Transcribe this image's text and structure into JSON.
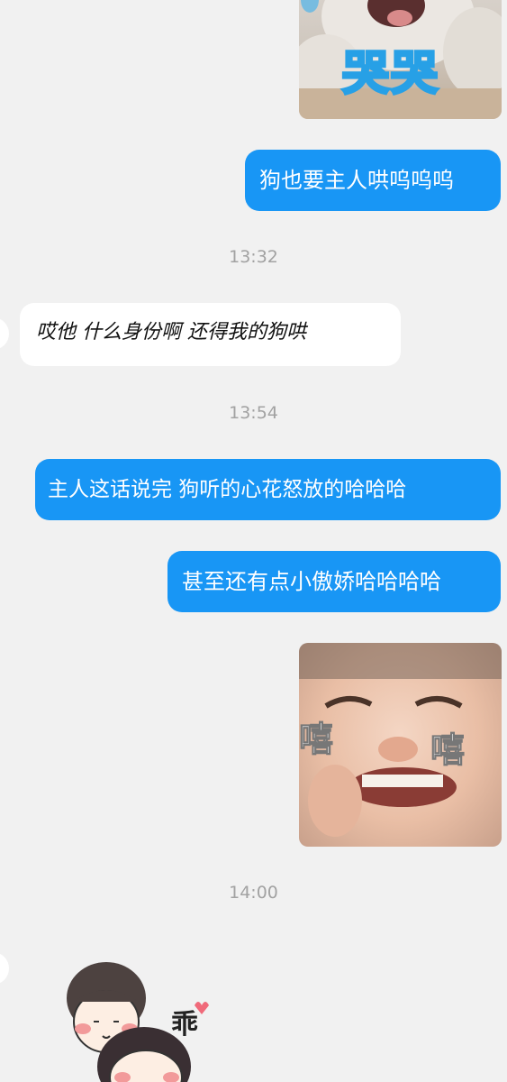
{
  "messages": [
    {
      "id": "m1",
      "type": "sticker",
      "side": "out",
      "caption": "哭哭",
      "icon": "crying-cat-sticker"
    },
    {
      "id": "m2",
      "type": "text",
      "side": "out",
      "text": "狗也要主人哄呜呜呜"
    },
    {
      "id": "t1",
      "type": "timestamp",
      "text": "13:32"
    },
    {
      "id": "m3",
      "type": "text",
      "side": "in",
      "text": "哎他 什么身份啊 还得我的狗哄"
    },
    {
      "id": "t2",
      "type": "timestamp",
      "text": "13:54"
    },
    {
      "id": "m4",
      "type": "text",
      "side": "out",
      "text": "主人这话说完 狗听的心花怒放的哈哈哈"
    },
    {
      "id": "m5",
      "type": "text",
      "side": "out",
      "text": "甚至还有点小傲娇哈哈哈哈"
    },
    {
      "id": "m6",
      "type": "sticker",
      "side": "out",
      "caption_left": "嘻",
      "caption_right": "嘻",
      "icon": "grinning-baby-sticker"
    },
    {
      "id": "t3",
      "type": "timestamp",
      "text": "14:00"
    },
    {
      "id": "m7",
      "type": "sticker",
      "side": "in",
      "caption": "乖",
      "icon": "cartoon-couple-sticker"
    }
  ],
  "colors": {
    "background": "#f1f1f1",
    "outgoing_bubble": "#1896f5",
    "incoming_bubble": "#ffffff",
    "timestamp_text": "#a2a2a2"
  }
}
